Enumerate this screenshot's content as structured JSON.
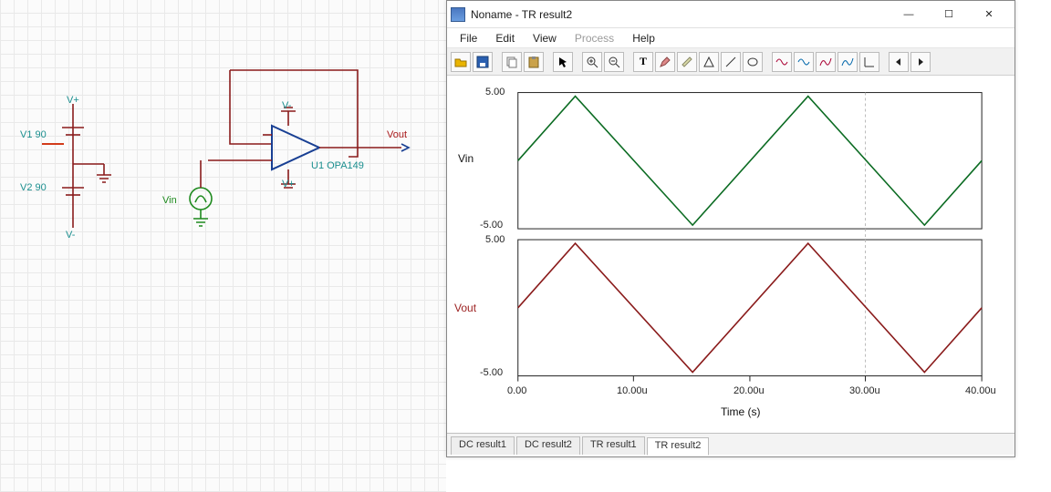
{
  "window": {
    "title": "Noname - TR result2",
    "controls": {
      "min": "—",
      "max": "☐",
      "close": "✕"
    }
  },
  "menu": {
    "file": "File",
    "edit": "Edit",
    "view": "View",
    "process": "Process",
    "help": "Help"
  },
  "toolbar_icons": [
    "folder-open-icon",
    "save-icon",
    "copy-icon",
    "paste-icon",
    "cursor-icon",
    "zoom-in-icon",
    "zoom-out-icon",
    "text-tool-icon",
    "pencil-icon",
    "ruler-icon",
    "shape-icon",
    "line-icon",
    "ellipse-icon",
    "wave1-icon",
    "wave2-icon",
    "curve1-icon",
    "curve2-icon",
    "angle-icon",
    "nav-prev-icon",
    "nav-next-icon"
  ],
  "tabs": {
    "items": [
      "DC result1",
      "DC result2",
      "TR result1",
      "TR result2"
    ],
    "active_index": 3
  },
  "axis": {
    "xlabel": "Time (s)",
    "xticks": [
      "0.00",
      "10.00u",
      "20.00u",
      "30.00u",
      "40.00u"
    ],
    "y1_label": "Vin",
    "y1_ticks": [
      "5.00",
      "-5.00"
    ],
    "y2_label": "Vout",
    "y2_ticks": [
      "5.00",
      "-5.00"
    ]
  },
  "schematic": {
    "v1": "V1 90",
    "v2": "V2 90",
    "vplus_top": "V+",
    "vminus_bot": "V-",
    "vminus_amp": "V-",
    "vplus_amp": "V+",
    "vin": "Vin",
    "opamp": "U1 OPA149",
    "vout": "Vout"
  },
  "chart_data": [
    {
      "type": "line",
      "title": "",
      "name": "Vin",
      "x_unit": "s",
      "x": [
        0,
        5e-06,
        1.5e-05,
        2.5e-05,
        3.5e-05,
        4e-05
      ],
      "y": [
        0,
        5,
        -5,
        5,
        -5,
        0
      ],
      "color": "#0b6b22",
      "xlim": [
        0,
        4e-05
      ],
      "ylim": [
        -5,
        5
      ],
      "ylabel": "Vin",
      "xlabel": "Time (s)"
    },
    {
      "type": "line",
      "title": "",
      "name": "Vout",
      "x_unit": "s",
      "x": [
        0,
        5e-06,
        1.5e-05,
        2.5e-05,
        3.5e-05,
        4e-05
      ],
      "y": [
        0,
        5,
        -5,
        5,
        -5,
        0
      ],
      "color": "#8a1b1b",
      "xlim": [
        0,
        4e-05
      ],
      "ylim": [
        -5,
        5
      ],
      "ylabel": "Vout",
      "xlabel": "Time (s)"
    }
  ]
}
